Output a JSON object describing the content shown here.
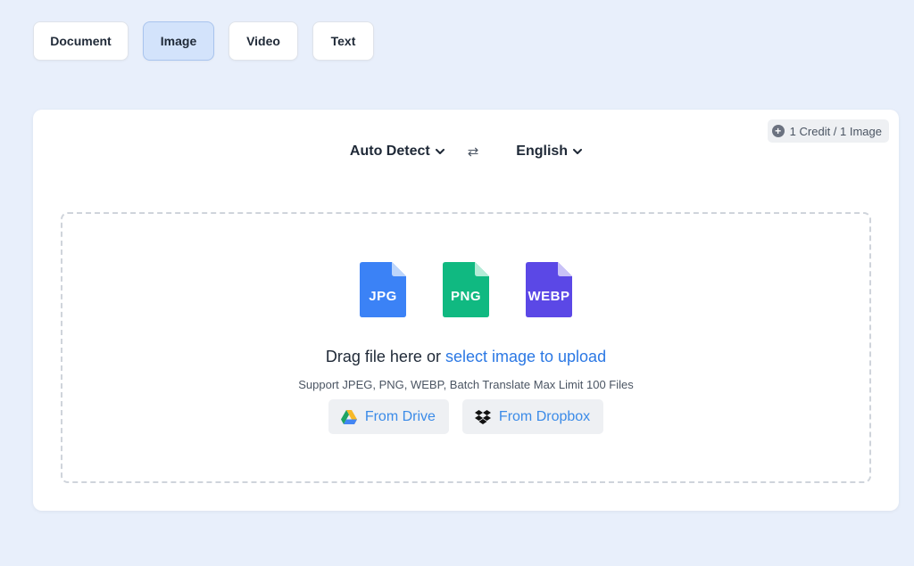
{
  "tabs": [
    {
      "label": "Document",
      "active": false
    },
    {
      "label": "Image",
      "active": true
    },
    {
      "label": "Video",
      "active": false
    },
    {
      "label": "Text",
      "active": false
    }
  ],
  "credit": {
    "icon": "credit-coin-icon",
    "text": "1 Credit / 1 Image"
  },
  "language": {
    "source": "Auto Detect",
    "swap_symbol": "⇄",
    "target": "English"
  },
  "dropzone": {
    "file_types": [
      {
        "label": "JPG",
        "color": "#3b82f6"
      },
      {
        "label": "PNG",
        "color": "#10b981"
      },
      {
        "label": "WEBP",
        "color": "#5b48e6"
      }
    ],
    "drag_text": "Drag file here or",
    "link_text": "select image to upload",
    "support_text": "Support JPEG, PNG, WEBP, Batch Translate Max Limit 100 Files",
    "sources": [
      {
        "label": "From Drive",
        "icon": "google-drive-icon"
      },
      {
        "label": "From Dropbox",
        "icon": "dropbox-icon"
      }
    ]
  },
  "colors": {
    "background": "#e8effb",
    "active_tab": "#d3e3fb",
    "link": "#2b78e4"
  }
}
